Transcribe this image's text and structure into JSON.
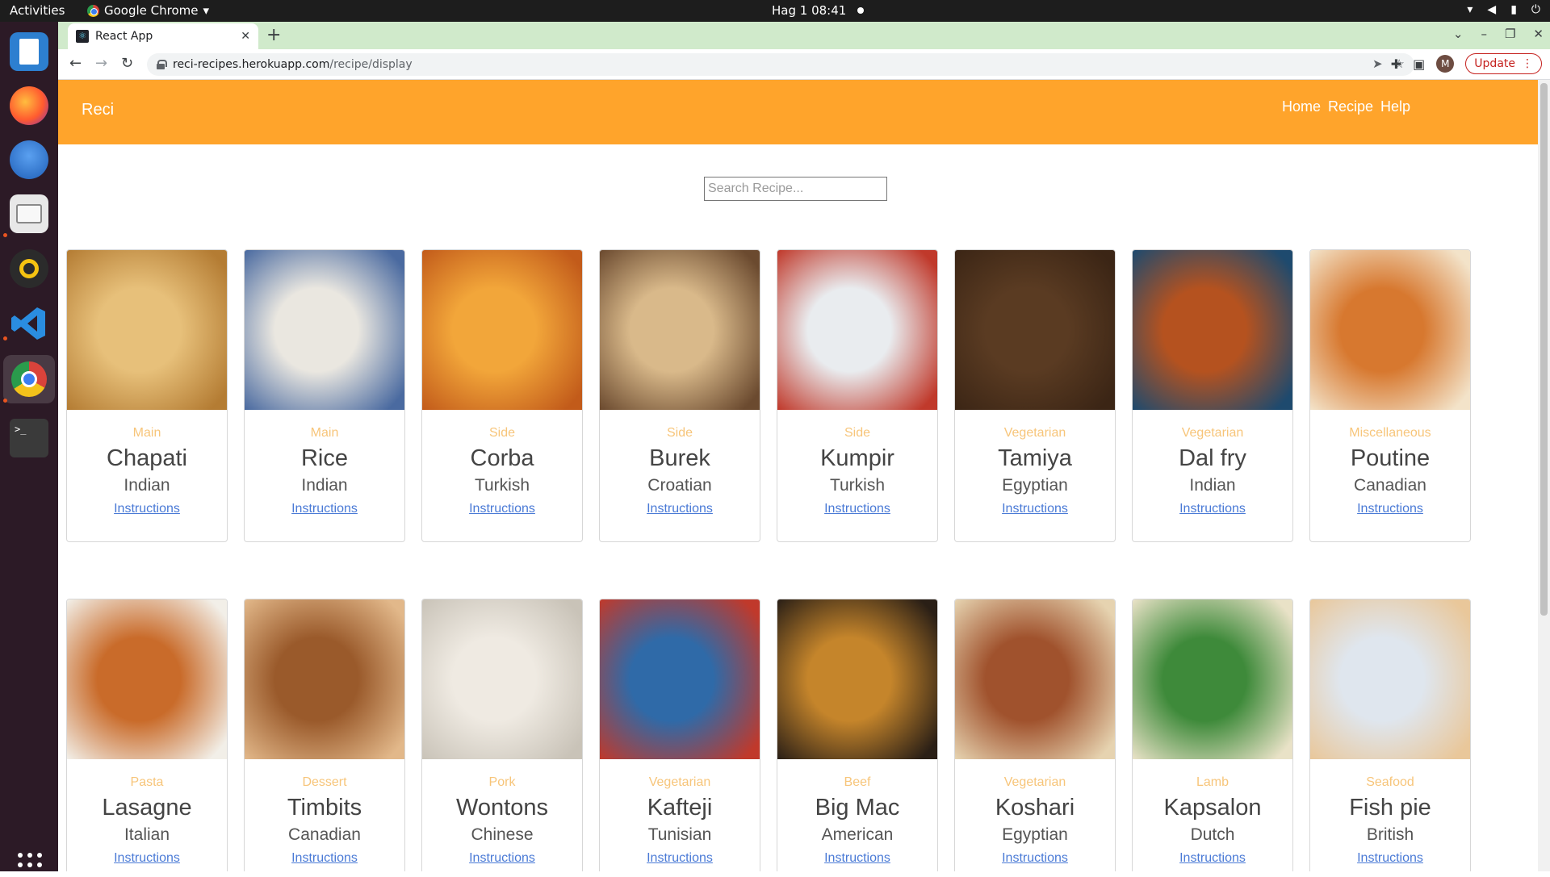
{
  "system": {
    "activities": "Activities",
    "app_menu": "Google Chrome",
    "clock": "Hag 1  08:41",
    "tray_icons": [
      "wifi-icon",
      "volume-icon",
      "battery-icon",
      "power-icon"
    ]
  },
  "dock": {
    "apps": [
      "libreoffice-writer",
      "firefox",
      "thunderbird",
      "files",
      "rhythmbox",
      "vscode",
      "google-chrome",
      "terminal"
    ]
  },
  "browser": {
    "tab_title": "React App",
    "url_host": "reci-recipes.herokuapp.com",
    "url_path": "/recipe/display",
    "profile_initial": "M",
    "update_label": "Update"
  },
  "page": {
    "brand": "Reci",
    "nav": [
      "Home",
      "Recipe",
      "Help"
    ],
    "search_placeholder": "Search Recipe...",
    "link_label": "Instructions",
    "recipes": [
      {
        "category": "Main",
        "name": "Chapati",
        "area": "Indian"
      },
      {
        "category": "Main",
        "name": "Rice",
        "area": "Indian"
      },
      {
        "category": "Side",
        "name": "Corba",
        "area": "Turkish"
      },
      {
        "category": "Side",
        "name": "Burek",
        "area": "Croatian"
      },
      {
        "category": "Side",
        "name": "Kumpir",
        "area": "Turkish"
      },
      {
        "category": "Vegetarian",
        "name": "Tamiya",
        "area": "Egyptian"
      },
      {
        "category": "Vegetarian",
        "name": "Dal fry",
        "area": "Indian"
      },
      {
        "category": "Miscellaneous",
        "name": "Poutine",
        "area": "Canadian"
      },
      {
        "category": "Pasta",
        "name": "Lasagne",
        "area": "Italian"
      },
      {
        "category": "Dessert",
        "name": "Timbits",
        "area": "Canadian"
      },
      {
        "category": "Pork",
        "name": "Wontons",
        "area": "Chinese"
      },
      {
        "category": "Vegetarian",
        "name": "Kafteji",
        "area": "Tunisian"
      },
      {
        "category": "Beef",
        "name": "Big Mac",
        "area": "American"
      },
      {
        "category": "Vegetarian",
        "name": "Koshari",
        "area": "Egyptian"
      },
      {
        "category": "Lamb",
        "name": "Kapsalon",
        "area": "Dutch"
      },
      {
        "category": "Seafood",
        "name": "Fish pie",
        "area": "British"
      }
    ],
    "photo_colors": [
      [
        "#e7c07a",
        "#b47c33"
      ],
      [
        "#eae7e0",
        "#4a6aa0"
      ],
      [
        "#f2a63a",
        "#c25b1a"
      ],
      [
        "#d9b98a",
        "#6b4a2f"
      ],
      [
        "#e9ecef",
        "#c0392b"
      ],
      [
        "#5a3b22",
        "#3b2515"
      ],
      [
        "#b5521f",
        "#1e4a6e"
      ],
      [
        "#d7782f",
        "#f3e3c9"
      ],
      [
        "#c96b2a",
        "#f2efe8"
      ],
      [
        "#9a5a2b",
        "#e2b88a"
      ],
      [
        "#efeae2",
        "#c9c3b8"
      ],
      [
        "#2f6aa8",
        "#c0392b"
      ],
      [
        "#c5852b",
        "#2a1f16"
      ],
      [
        "#a0522d",
        "#e6d3b0"
      ],
      [
        "#3e8a3a",
        "#e9e2c7"
      ],
      [
        "#dfe6ee",
        "#e9c79a"
      ]
    ]
  }
}
